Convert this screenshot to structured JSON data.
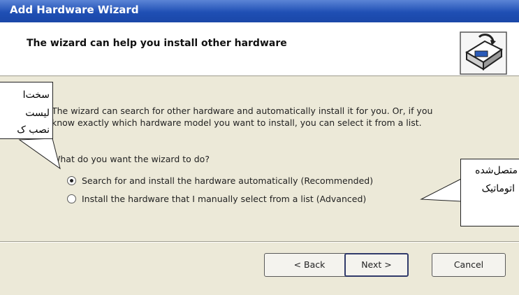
{
  "window": {
    "title": "Add Hardware Wizard"
  },
  "header": {
    "heading": "The wizard can help you install other hardware"
  },
  "icons": {
    "wizard": "hardware-wizard-icon"
  },
  "main": {
    "description_line1": "The wizard can search for other hardware and automatically install it for you. Or, if you",
    "description_line2": "know exactly which hardware model you want to install, you can select it from a list.",
    "question": "What do you want the wizard to do?",
    "options": [
      {
        "label": "Search for and install the hardware automatically (Recommended)",
        "checked": true
      },
      {
        "label": "Install the hardware that I manually select from a list (Advanced)",
        "checked": false
      }
    ]
  },
  "buttons": {
    "back": "< Back",
    "next": "Next >",
    "cancel": "Cancel"
  },
  "callouts": {
    "left": [
      "سخت‌ا",
      "لیست",
      "نصب ک"
    ],
    "right": [
      "متصل‌شده",
      "اتوماتیک"
    ]
  },
  "colors": {
    "titlebar": "#1f4fb4",
    "dialog": "#ece9d8"
  }
}
